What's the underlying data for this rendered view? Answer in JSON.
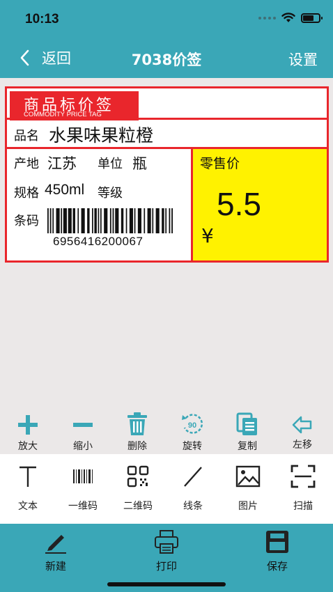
{
  "status_bar": {
    "time": "10:13"
  },
  "nav": {
    "back_label": "返回",
    "title": "7038价签",
    "settings_label": "设置"
  },
  "label": {
    "header_cn": "商品标价签",
    "header_en": "COMMODITY PRICE TAG",
    "name_label": "品名",
    "name_value": "水果味果粒橙",
    "origin_label": "产地",
    "origin_value": "江苏",
    "unit_label": "单位",
    "unit_value": "瓶",
    "spec_label": "规格",
    "spec_value": "450ml",
    "grade_label": "等级",
    "barcode_label": "条码",
    "barcode_number": "6956416200067",
    "price_label": "零售价",
    "price_value": "5.5",
    "currency_symbol": "¥"
  },
  "edit_tools": [
    {
      "label": "放大",
      "icon": "plus-icon"
    },
    {
      "label": "缩小",
      "icon": "minus-icon"
    },
    {
      "label": "删除",
      "icon": "trash-icon"
    },
    {
      "label": "旋转",
      "icon": "rotate-90-icon"
    },
    {
      "label": "复制",
      "icon": "copy-icon"
    },
    {
      "label": "左移",
      "icon": "arrow-left-icon"
    }
  ],
  "insert_tools": [
    {
      "label": "文本",
      "icon": "text-icon"
    },
    {
      "label": "一维码",
      "icon": "barcode-icon"
    },
    {
      "label": "二维码",
      "icon": "qrcode-icon"
    },
    {
      "label": "线条",
      "icon": "line-icon"
    },
    {
      "label": "图片",
      "icon": "image-icon"
    },
    {
      "label": "扫描",
      "icon": "scan-icon"
    }
  ],
  "bottom_nav": [
    {
      "label": "新建",
      "icon": "pencil-icon"
    },
    {
      "label": "打印",
      "icon": "printer-icon"
    },
    {
      "label": "保存",
      "icon": "save-icon"
    }
  ],
  "rotate_badge": "90",
  "colors": {
    "header_bg": "#3aa7b7",
    "tag_red": "#e9262c",
    "price_yellow": "#fff200",
    "tool_blue": "#3aa7b7"
  }
}
